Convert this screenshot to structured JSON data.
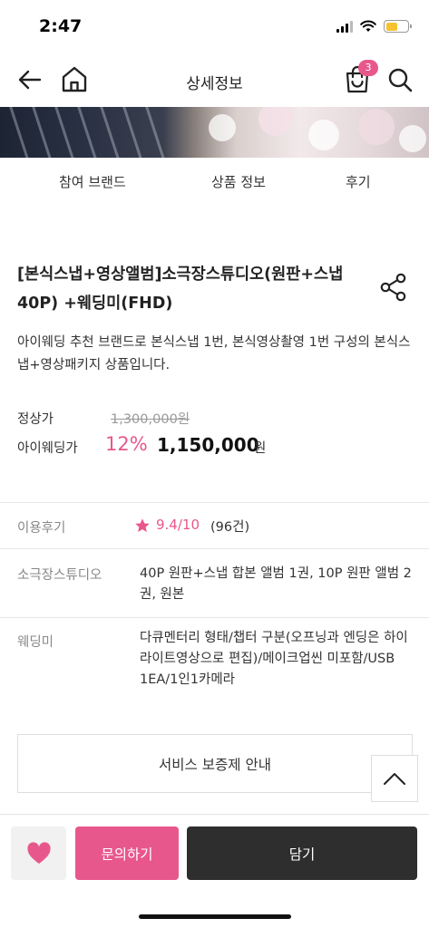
{
  "status_bar": {
    "time": "2:47",
    "battery_level": 0.55,
    "battery_color": "#f6c232"
  },
  "header": {
    "title": "상세정보",
    "cart_count": "3"
  },
  "tabs": [
    {
      "label": "참여 브랜드"
    },
    {
      "label": "상품 정보"
    },
    {
      "label": "후기"
    }
  ],
  "product": {
    "title": "[본식스냅+영상앨범]소극장스튜디오(원판+스냅 40P) +웨딩미(FHD)",
    "description": "아이웨딩 추천 브랜드로 본식스냅 1번, 본식영상촬영 1번 구성의 본식스냅+영상패키지 상품입니다.",
    "regular_label": "정상가",
    "regular_price": "1,300,000원",
    "sale_label": "아이웨딩가",
    "discount": "12%",
    "sale_price": "1,150,000",
    "sale_unit": "원"
  },
  "info": {
    "review_label": "이용후기",
    "rating": "9.4/10",
    "review_count": "(96건)",
    "studio_label": "소극장스튜디오",
    "studio_value": "40P 원판+스냅 합본 앨범 1권, 10P 원판 앨범 2권, 원본",
    "video_label": "웨딩미",
    "video_value": "다큐멘터리 형태/챕터 구분(오프닝과 엔딩은 하이라이트영상으로 편집)/메이크업씬 미포함/USB 1EA/1인1카메라"
  },
  "service_button": "서비스 보증제 안내",
  "bottom_bar": {
    "inquiry_label": "문의하기",
    "add_label": "담기"
  },
  "colors": {
    "accent": "#e8578c",
    "dark": "#2e2e2e"
  }
}
